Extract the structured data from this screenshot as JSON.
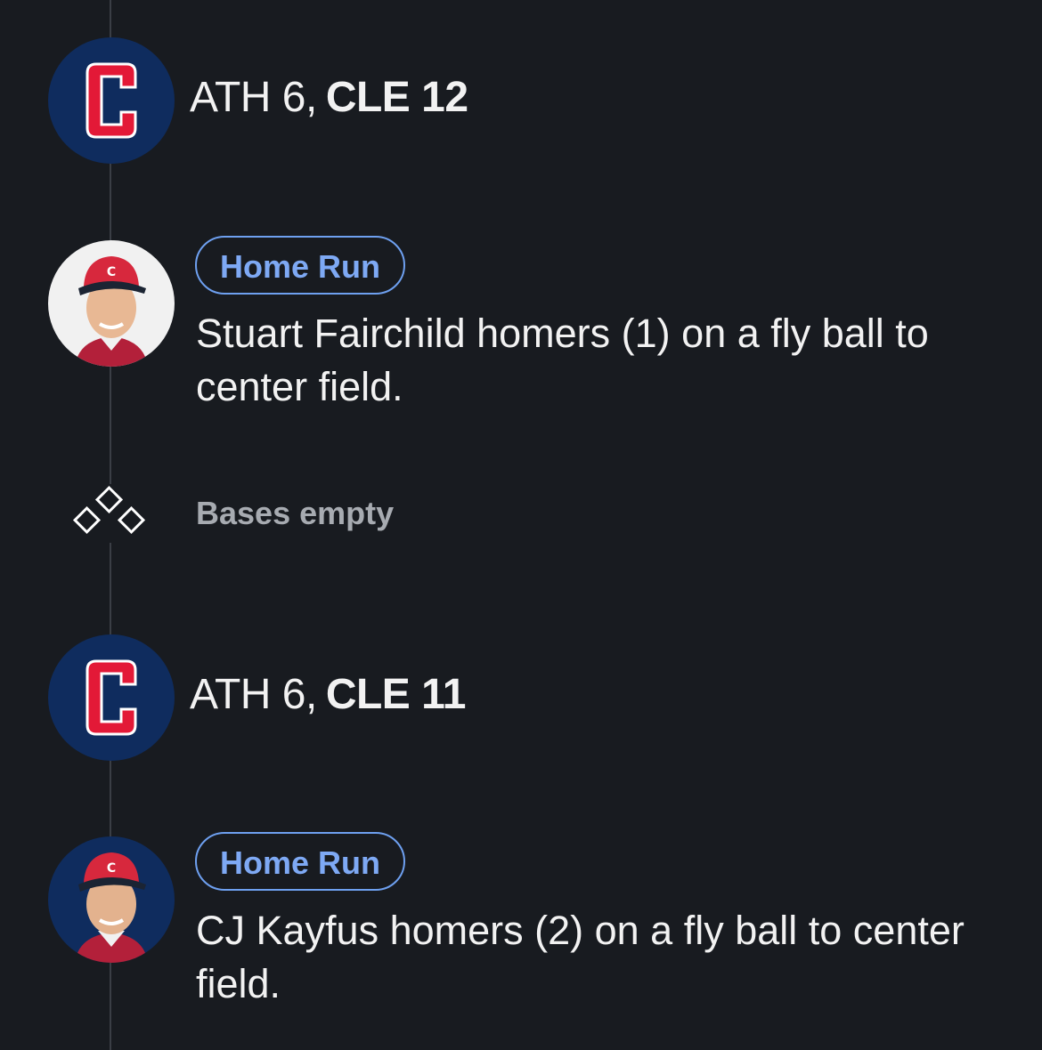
{
  "events": [
    {
      "type": "score",
      "team_logo_icon": "cleveland-c-logo-icon",
      "away": "ATH 6,",
      "home": "CLE 12"
    },
    {
      "type": "play",
      "badge": "Home Run",
      "avatar_icon": "player-headshot-icon",
      "description": "Stuart Fairchild homers (1) on a fly ball to center field."
    },
    {
      "type": "bases",
      "icon": "bases-diamond-icon",
      "text": "Bases empty"
    },
    {
      "type": "score",
      "team_logo_icon": "cleveland-c-logo-icon",
      "away": "ATH 6,",
      "home": "CLE 11"
    },
    {
      "type": "play",
      "badge": "Home Run",
      "avatar_icon": "player-headshot-icon",
      "description": "CJ Kayfus homers (2) on a fly ball to center field."
    }
  ],
  "colors": {
    "background": "#181b20",
    "timeline": "#3a3e45",
    "team_navy": "#0f2c5e",
    "team_red": "#e31937",
    "badge_blue": "#7ea9f4",
    "muted_text": "#a7abb1"
  }
}
